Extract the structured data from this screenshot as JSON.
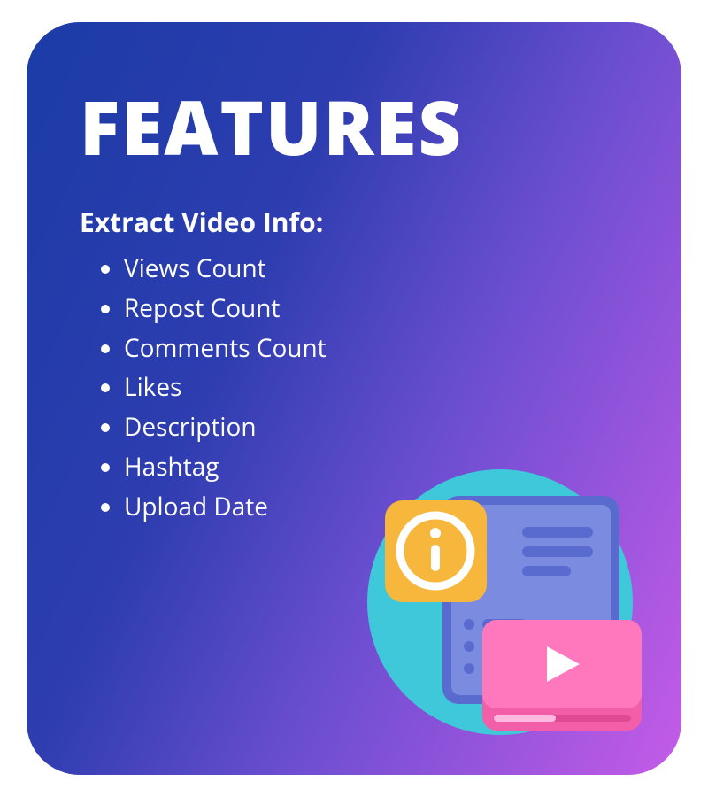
{
  "title": "FEATURES",
  "subtitle": "Extract Video Info:",
  "items": [
    "Views Count",
    "Repost Count",
    "Comments Count",
    "Likes",
    "Description",
    "Hashtag",
    "Upload Date"
  ]
}
